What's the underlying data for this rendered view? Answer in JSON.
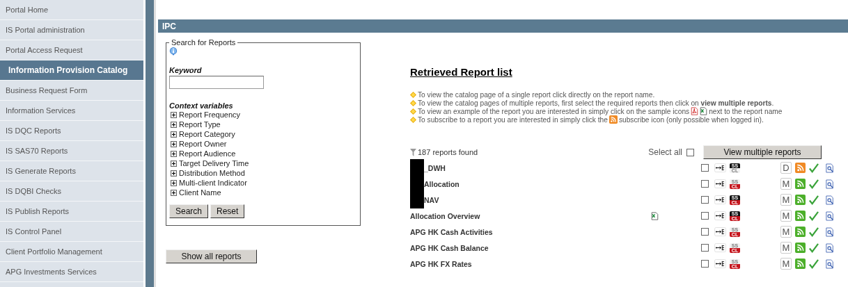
{
  "sidebar": {
    "items": [
      {
        "label": "Portal Home",
        "selected": false
      },
      {
        "label": "IS Portal administration",
        "selected": false
      },
      {
        "label": "Portal Access Request",
        "selected": false
      },
      {
        "label": "Information Provision Catalog",
        "selected": true
      },
      {
        "label": "Business Request Form",
        "selected": false
      },
      {
        "label": "Information Services",
        "selected": false
      },
      {
        "label": "IS DQC Reports",
        "selected": false
      },
      {
        "label": "IS SAS70 Reports",
        "selected": false
      },
      {
        "label": "IS Generate Reports",
        "selected": false
      },
      {
        "label": "IS DQBI Checks",
        "selected": false
      },
      {
        "label": "IS Publish Reports",
        "selected": false
      },
      {
        "label": "IS Control Panel",
        "selected": false
      },
      {
        "label": "Client Portfolio Management",
        "selected": false
      },
      {
        "label": "APG Investments Services",
        "selected": false
      }
    ]
  },
  "header": {
    "title": "IPC"
  },
  "search_panel": {
    "legend": "Search for Reports",
    "keyword_label": "Keyword",
    "context_label": "Context variables",
    "context_variables": [
      {
        "label": "Report Frequency",
        "expanded": false
      },
      {
        "label": "Report Type",
        "expanded": false
      },
      {
        "label": "Report Category",
        "expanded": false
      },
      {
        "label": "Report Owner",
        "expanded": false
      },
      {
        "label": "Report Audience",
        "expanded": false
      },
      {
        "label": "Target Delivery Time",
        "expanded": false
      },
      {
        "label": "Distribution Method",
        "expanded": false
      },
      {
        "label": "Multi-client Indicator",
        "expanded": false
      },
      {
        "label": "Client Name",
        "expanded": false
      }
    ],
    "buttons": [
      "Search",
      "Reset"
    ]
  },
  "show_all_button": "Show all reports",
  "report_list": {
    "title": "Retrieved Report list",
    "instructions": [
      {
        "text": "To view the catalog page of a single report click directly on the report name."
      },
      {
        "text": "To view the catalog pages of multiple reports, first select the required reports then click on **view multiple reports**."
      },
      {
        "text": "To view an example of the report you are interested in simply click on the sample icons",
        "inline_icons": [
          {
            "kind": "pdf"
          },
          {
            "kind": "excel"
          }
        ],
        "text_after": "next to the report name"
      },
      {
        "text": "To subscribe to a report you are interested in simply click the",
        "inline_icons": [
          {
            "kind": "rss"
          }
        ],
        "text_after": "subscribe icon (only possible when logged in)."
      }
    ],
    "count": "187 reports found",
    "select_all_label": "Select all",
    "select_all_checked": false,
    "view_button": "View multiple reports",
    "rows": [
      {
        "name": "_DWH",
        "redacted": true,
        "sample": false,
        "checked": false,
        "ss": "SS",
        "cl": "CL",
        "ss_on": true,
        "cl_on": false,
        "frequency": "D",
        "color": "#f08a24"
      },
      {
        "name": "Allocation",
        "redacted": true,
        "sample": false,
        "checked": false,
        "ss": "SS",
        "cl": "CL",
        "ss_on": false,
        "cl_on": true,
        "frequency": "M",
        "color": "#4caf2a"
      },
      {
        "name": "NAV",
        "redacted": true,
        "sample": false,
        "checked": false,
        "ss": "SS",
        "cl": "CL",
        "ss_on": true,
        "cl_on": true,
        "frequency": "M",
        "color": "#4caf2a"
      },
      {
        "name": "Allocation Overview",
        "redacted": false,
        "sample": true,
        "checked": false,
        "ss": "SS",
        "cl": "CL",
        "ss_on": true,
        "cl_on": true,
        "frequency": "M",
        "color": "#4caf2a"
      },
      {
        "name": "APG HK Cash Activities",
        "redacted": false,
        "sample": false,
        "checked": false,
        "ss": "SS",
        "cl": "CL",
        "ss_on": false,
        "cl_on": true,
        "frequency": "M",
        "color": "#4caf2a"
      },
      {
        "name": "APG HK Cash Balance",
        "redacted": false,
        "sample": false,
        "checked": false,
        "ss": "SS",
        "cl": "CL",
        "ss_on": false,
        "cl_on": true,
        "frequency": "M",
        "color": "#4caf2a"
      },
      {
        "name": "APG HK FX Rates",
        "redacted": false,
        "sample": false,
        "checked": false,
        "ss": "SS",
        "cl": "CL",
        "ss_on": false,
        "cl_on": true,
        "frequency": "M",
        "color": "#4caf2a"
      }
    ]
  }
}
